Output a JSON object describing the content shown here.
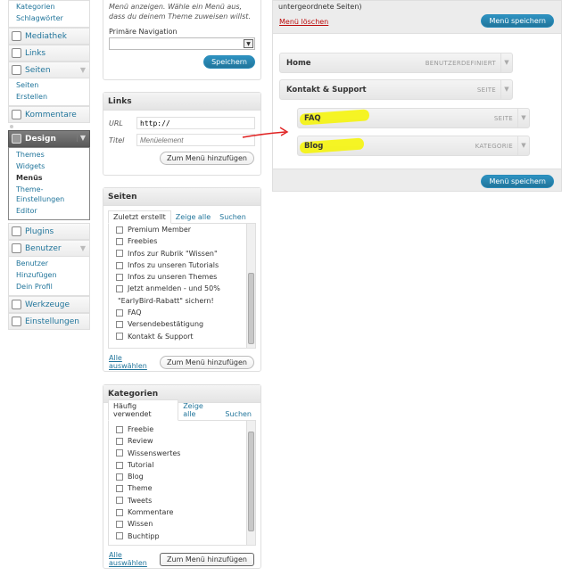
{
  "sidebar": {
    "posts_sub": [
      "Kategorien",
      "Schlagwörter"
    ],
    "media": "Mediathek",
    "links": "Links",
    "pages": "Seiten",
    "pages_sub": [
      "Seiten",
      "Erstellen"
    ],
    "comments": "Kommentare",
    "design": "Design",
    "design_sub": [
      "Themes",
      "Widgets",
      "Menüs",
      "Theme-Einstellungen",
      "Editor"
    ],
    "plugins": "Plugins",
    "users": "Benutzer",
    "users_sub": [
      "Benutzer",
      "Hinzufügen",
      "Dein Profil"
    ],
    "tools": "Werkzeuge",
    "settings": "Einstellungen"
  },
  "theme_locations": {
    "intro": "Menü anzeigen. Wähle ein Menü aus, dass du deinem Theme zuweisen willst.",
    "location_label": "Primäre Navigation",
    "save": "Speichern"
  },
  "links_box": {
    "title": "Links",
    "url_label": "URL",
    "url_value": "http://",
    "title_label": "Titel",
    "title_placeholder": "Menüelement",
    "add": "Zum Menü hinzufügen"
  },
  "pages_box": {
    "title": "Seiten",
    "tabs": [
      "Zuletzt erstellt",
      "Zeige alle",
      "Suchen"
    ],
    "items": [
      "Premium Member",
      "Freebies",
      "Infos zur Rubrik \"Wissen\"",
      "Infos zu unseren Tutorials",
      "Infos zu unseren Themes",
      "Jetzt anmelden - und 50%",
      "\"EarlyBird-Rabatt\" sichern!",
      "FAQ",
      "Versendebestätigung",
      "Kontakt & Support"
    ],
    "select_all": "Alle auswählen",
    "add": "Zum Menü hinzufügen"
  },
  "categories_box": {
    "title": "Kategorien",
    "tabs": [
      "Häufig verwendet",
      "Zeige alle",
      "Suchen"
    ],
    "items": [
      "Freebie",
      "Review",
      "Wissenswertes",
      "Tutorial",
      "Blog",
      "Theme",
      "Tweets",
      "Kommentare",
      "Wissen",
      "Buchtipp"
    ],
    "select_all": "Alle auswählen",
    "add": "Zum Menü hinzufügen"
  },
  "menu_editor": {
    "top_text": "untergeordnete Seiten)",
    "delete": "Menü löschen",
    "save": "Menü speichern",
    "items": [
      {
        "title": "Home",
        "type": "BENUTZERDEFINIERT"
      },
      {
        "title": "Kontakt & Support",
        "type": "SEITE"
      },
      {
        "title": "FAQ",
        "type": "SEITE"
      },
      {
        "title": "Blog",
        "type": "KATEGORIE"
      }
    ],
    "save_bottom": "Menü speichern"
  },
  "colors": {
    "link": "#21759b",
    "highlight": "#f6f500",
    "arrow": "#e02020",
    "delete": "#bc0b0b"
  }
}
